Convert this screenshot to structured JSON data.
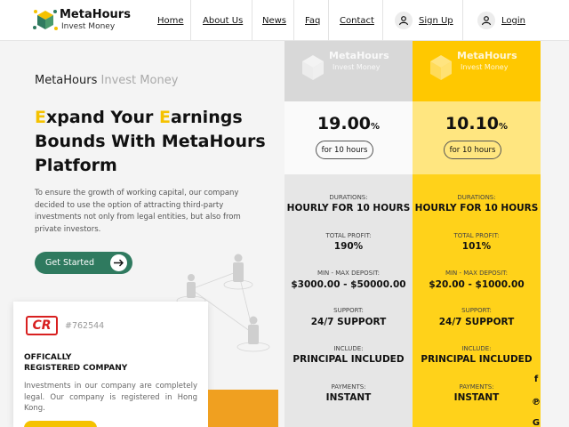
{
  "header": {
    "logo_title": "MetaHours",
    "logo_subtitle": "Invest Money",
    "nav": [
      "Home",
      "About Us",
      "News",
      "Faq",
      "Contact"
    ],
    "signup_label": "Sign Up",
    "login_label": "Login"
  },
  "hero": {
    "brand_main": "MetaHours",
    "brand_sub": "Invest Money",
    "title_line1_cap": "E",
    "title_line1_a": "xpand Your ",
    "title_line1_cap2": "E",
    "title_line1_b": "arnings",
    "title_line2": "Bounds With MetaHours",
    "title_line3": "Platform",
    "text": "To ensure the growth of working capital, our company decided to use the option of attracting third-party investments not only from legal entities, but also from private investors.",
    "cta_label": "Get Started"
  },
  "certificate": {
    "logo_text": "CR",
    "number": "#762544",
    "title_line1": "OFFICALLY",
    "title_line2": "REGISTERED COMPANY",
    "text": "Investments in our company are completely legal. Our company is registered in Hong Kong."
  },
  "plans": [
    {
      "logo_title": "MetaHours",
      "logo_subtitle": "Invest Money",
      "rate": "19.00",
      "rate_unit": "%",
      "period": "for 10 hours",
      "durations_label": "DURATIONS:",
      "durations": "HOURLY FOR 10 HOURS",
      "profit_label": "TOTAL PROFIT:",
      "profit": "190%",
      "deposit_label": "MIN - MAX DEPOSIT:",
      "deposit": "$3000.00 - $50000.00",
      "support_label": "SUPPORT:",
      "support": "24/7 SUPPORT",
      "include_label": "INCLUDE:",
      "include": "PRINCIPAL INCLUDED",
      "payments_label": "PAYMENTS:",
      "payments": "INSTANT"
    },
    {
      "logo_title": "MetaHours",
      "logo_subtitle": "Invest Money",
      "rate": "10.10",
      "rate_unit": "%",
      "period": "for 10 hours",
      "durations_label": "DURATIONS:",
      "durations": "HOURLY FOR 10 HOURS",
      "profit_label": "TOTAL PROFIT:",
      "profit": "101%",
      "deposit_label": "MIN - MAX DEPOSIT:",
      "deposit": "$20.00 - $1000.00",
      "support_label": "SUPPORT:",
      "support": "24/7 SUPPORT",
      "include_label": "INCLUDE:",
      "include": "PRINCIPAL INCLUDED",
      "payments_label": "PAYMENTS:",
      "payments": "INSTANT"
    }
  ],
  "social": {
    "facebook": "f",
    "pinterest": "℗",
    "google": "G"
  },
  "colors": {
    "accent_yellow": "#ffd21a",
    "cta_green": "#2f7a5f",
    "cert_red": "#d82020"
  }
}
